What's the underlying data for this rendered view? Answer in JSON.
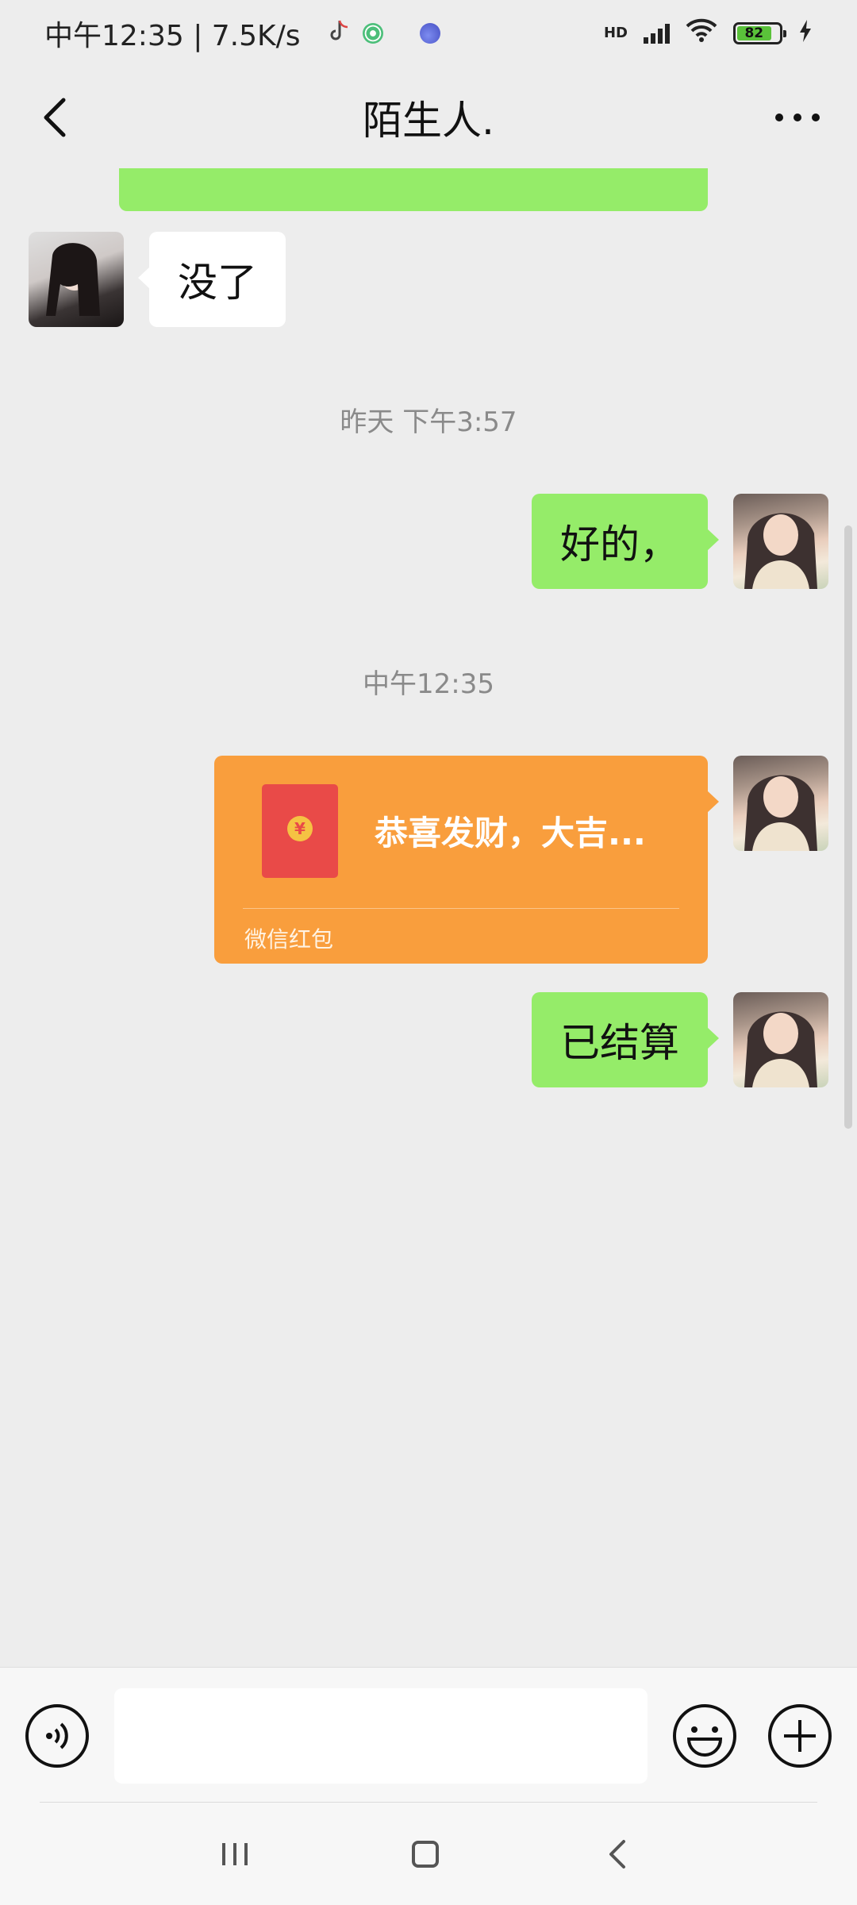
{
  "status_bar": {
    "time_speed": "中午12:35 | 7.5K/s",
    "network": "HD",
    "battery": "82",
    "battery_level": 0.82
  },
  "nav": {
    "title": "陌生人.",
    "back_icon": "chevron-left-icon",
    "more_icon": "more-dots-icon"
  },
  "messages": [
    {
      "type": "text",
      "side": "left",
      "text": "没了"
    },
    {
      "type": "timestamp",
      "text": "昨天 下午3:57"
    },
    {
      "type": "text",
      "side": "right",
      "text": "好的，"
    },
    {
      "type": "timestamp",
      "text": "中午12:35"
    },
    {
      "type": "red_packet",
      "side": "right",
      "title": "恭喜发财，大吉...",
      "label": "微信红包",
      "coin": "¥"
    },
    {
      "type": "text",
      "side": "right",
      "text": "已结算"
    }
  ],
  "input_bar": {
    "voice_icon": "voice-icon",
    "input_value": "",
    "emoji_icon": "emoji-icon",
    "plus_icon": "plus-icon"
  },
  "colors": {
    "background": "#ededed",
    "bubble_green": "#95ec69",
    "bubble_white": "#ffffff",
    "red_packet": "#f99e3d",
    "red_packet_icon": "#e94a48"
  }
}
